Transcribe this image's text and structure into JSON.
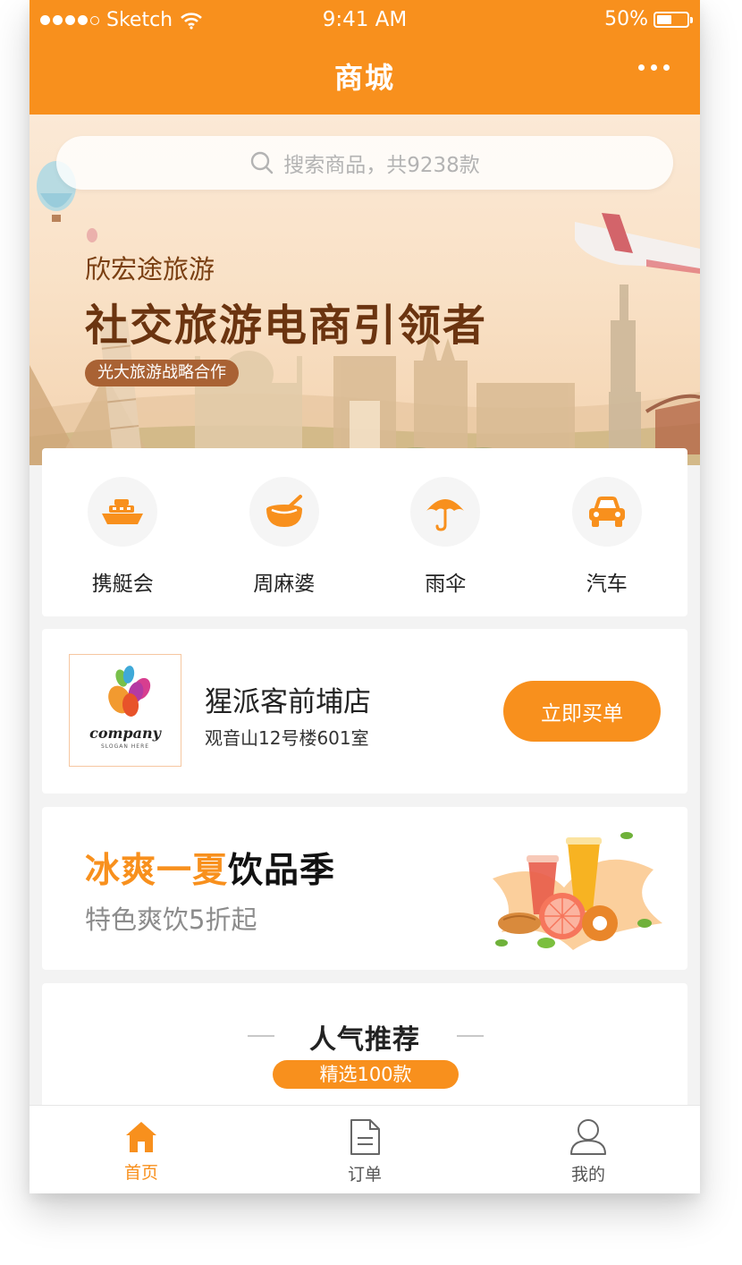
{
  "status_bar": {
    "carrier": "Sketch",
    "time": "9:41 AM",
    "battery": "50%"
  },
  "nav": {
    "title": "商城",
    "more_icon": "more-dots-icon"
  },
  "banner": {
    "search_placeholder": "搜索商品，共9238款",
    "subtitle": "欣宏途旅游",
    "title": "社交旅游电商引领者",
    "tag": "光大旅游战略合作"
  },
  "categories": [
    {
      "label": "携艇会",
      "icon": "ship-icon"
    },
    {
      "label": "周麻婆",
      "icon": "bowl-icon"
    },
    {
      "label": "雨伞",
      "icon": "umbrella-icon"
    },
    {
      "label": "汽车",
      "icon": "car-icon"
    }
  ],
  "store": {
    "logo_text": "company",
    "logo_slogan": "SLOGAN HERE",
    "name": "猩派客前埔店",
    "address": "观音山12号楼601室",
    "buy_label": "立即买单"
  },
  "promo": {
    "title_highlight": "冰爽一夏",
    "title_rest": "饮品季",
    "subtitle": "特色爽饮5折起"
  },
  "recommend": {
    "title": "人气推荐",
    "tag": "精选100款"
  },
  "tabbar": [
    {
      "label": "首页",
      "icon": "home-icon",
      "active": true
    },
    {
      "label": "订单",
      "icon": "document-icon",
      "active": false
    },
    {
      "label": "我的",
      "icon": "user-icon",
      "active": false
    }
  ],
  "colors": {
    "accent": "#f8901d",
    "banner_text": "#6b3410",
    "background": "#f3f3f3"
  }
}
